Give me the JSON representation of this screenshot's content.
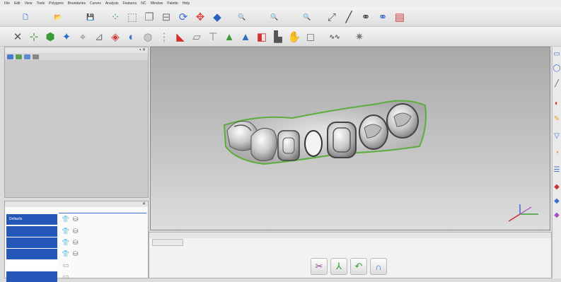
{
  "menu": {
    "items": [
      "File",
      "Edit",
      "View",
      "Tools",
      "Polygons",
      "Boundaries",
      "Curves",
      "Analysis",
      "Features",
      "NC",
      "Window",
      "Palette",
      "Help"
    ]
  },
  "toolbar1": {
    "icons": [
      {
        "name": "new-file-icon",
        "glyph": "🗋",
        "color": "#3a6fd0"
      },
      {
        "name": "open-file-icon",
        "glyph": "📂",
        "color": "#e0a020"
      },
      {
        "name": "save-icon",
        "glyph": "💾",
        "color": "#3355aa"
      },
      {
        "name": "point-cloud-icon",
        "glyph": "⁘",
        "color": "#4aa04a"
      },
      {
        "name": "cube-wire-icon",
        "glyph": "⬚",
        "color": "#888888"
      },
      {
        "name": "copy-model-icon",
        "glyph": "❐",
        "color": "#7a7a7a"
      },
      {
        "name": "surface-icon",
        "glyph": "⊟",
        "color": "#7a7a7a"
      },
      {
        "name": "rotate-view-icon",
        "glyph": "⟳",
        "color": "#3a6fd0"
      },
      {
        "name": "pan-view-icon",
        "glyph": "✥",
        "color": "#e04040"
      },
      {
        "name": "shaded-model-icon",
        "glyph": "◆",
        "color": "#2a60c0"
      },
      {
        "name": "zoom-in-icon",
        "glyph": "🔍",
        "color": "#3a6fd0"
      },
      {
        "name": "zoom-out-icon",
        "glyph": "🔍",
        "color": "#5a8ad8"
      },
      {
        "name": "zoom-window-icon",
        "glyph": "🔍",
        "color": "#7aa0dd"
      },
      {
        "name": "zoom-fit-icon",
        "glyph": "⤢",
        "color": "#555555"
      },
      {
        "name": "measure-tool-icon",
        "glyph": "╱",
        "color": "#333333"
      },
      {
        "name": "binocular-icon",
        "glyph": "⚭",
        "color": "#333333"
      },
      {
        "name": "binocular-alt-icon",
        "glyph": "⚭",
        "color": "#2a60c0"
      },
      {
        "name": "window-layout-icon",
        "glyph": "▤",
        "color": "#d04040"
      }
    ]
  },
  "toolbar2": {
    "icons": [
      {
        "name": "delete-icon",
        "glyph": "✕",
        "color": "#555555"
      },
      {
        "name": "select-points-icon",
        "glyph": "⊹",
        "color": "#3a9a3a"
      },
      {
        "name": "mesh-patch-icon",
        "glyph": "⬢",
        "color": "#3a9a3a"
      },
      {
        "name": "mesh-fill-icon",
        "glyph": "✦",
        "color": "#2a70c0"
      },
      {
        "name": "transform-icon",
        "glyph": "⌖",
        "color": "#888888"
      },
      {
        "name": "mesh-edit-icon",
        "glyph": "⊿",
        "color": "#7a7a7a"
      },
      {
        "name": "mesh-color-icon",
        "glyph": "◈",
        "color": "#d04040"
      },
      {
        "name": "smooth-icon",
        "glyph": "◐",
        "color": "#3a6fd0"
      },
      {
        "name": "decimate-icon",
        "glyph": "◍",
        "color": "#999999"
      },
      {
        "name": "separator-icon",
        "glyph": "⋮",
        "color": "#999999"
      },
      {
        "name": "boolean-icon",
        "glyph": "◣",
        "color": "#d03030"
      },
      {
        "name": "section-icon",
        "glyph": "⏥",
        "color": "#7a7a7a"
      },
      {
        "name": "trim-icon",
        "glyph": "⊤",
        "color": "#7a7a7a"
      },
      {
        "name": "fill-holes-icon",
        "glyph": "▲",
        "color": "#3a9a3a"
      },
      {
        "name": "shell-icon",
        "glyph": "▲",
        "color": "#2a70c0"
      },
      {
        "name": "thicken-icon",
        "glyph": "◧",
        "color": "#d03030"
      },
      {
        "name": "offset-icon",
        "glyph": "▙",
        "color": "#555555"
      },
      {
        "name": "sculpt-icon",
        "glyph": "✋",
        "color": "#888888"
      },
      {
        "name": "box-icon",
        "glyph": "◻",
        "color": "#777777"
      },
      {
        "name": "curve-tools-icon",
        "glyph": "∿∿",
        "color": "#555555"
      },
      {
        "name": "settings-icon",
        "glyph": "✷",
        "color": "#7a7a7a"
      }
    ]
  },
  "project_panel": {
    "buttons": [
      "#4a7ad0",
      "#5aa05a",
      "#5a8ad0",
      "#888888"
    ]
  },
  "color_panel": {
    "rows": [
      {
        "label": "Defaults",
        "icon": "👕"
      },
      {
        "label": "",
        "icon": "👕"
      },
      {
        "label": "",
        "icon": "👕"
      },
      {
        "label": "",
        "icon": "👕"
      },
      {
        "label": "",
        "icon": "▭"
      },
      {
        "label": "",
        "icon": "▭"
      }
    ]
  },
  "workflow": {
    "buttons": [
      {
        "name": "scissors-button",
        "glyph": "✂",
        "color": "#8a3f8a"
      },
      {
        "name": "split-button",
        "glyph": "⅄",
        "color": "#3a9a3a"
      },
      {
        "name": "undo-button",
        "glyph": "↶",
        "color": "#3a9a3a"
      },
      {
        "name": "shape-button",
        "glyph": "∩",
        "color": "#3a7ad0"
      }
    ]
  },
  "right_toolbar": {
    "icons": [
      {
        "name": "select-rect-icon",
        "glyph": "▭",
        "color": "#3a6fd0"
      },
      {
        "name": "select-lasso-icon",
        "glyph": "◯",
        "color": "#3a6fd0"
      },
      {
        "name": "select-line-icon",
        "glyph": "╱",
        "color": "#555555"
      },
      {
        "name": "eraser-icon",
        "glyph": "◐",
        "color": "#d03030"
      },
      {
        "name": "brush-icon",
        "glyph": "✎",
        "color": "#e0a020"
      },
      {
        "name": "selection-filter-icon",
        "glyph": "▽",
        "color": "#3a6fd0"
      },
      {
        "name": "color-pie-icon",
        "glyph": "◔",
        "color": "#e08020"
      },
      {
        "name": "layers-icon",
        "glyph": "☰",
        "color": "#3a6fd0"
      },
      {
        "name": "mark-red-icon",
        "glyph": "◆",
        "color": "#d03030"
      },
      {
        "name": "mark-blue-icon",
        "glyph": "◆",
        "color": "#3a6fd0"
      },
      {
        "name": "mark-multi-icon",
        "glyph": "◆",
        "color": "#a050c0"
      }
    ]
  }
}
